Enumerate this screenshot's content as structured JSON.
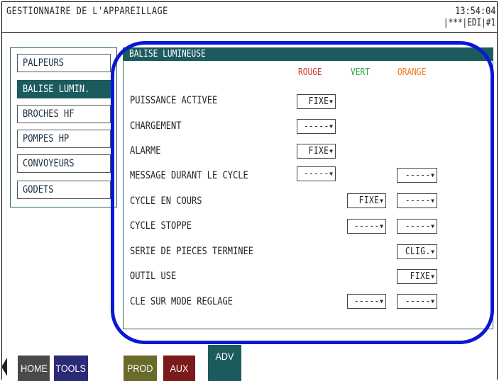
{
  "header": {
    "title": "GESTIONNAIRE DE L'APPAREILLAGE",
    "time": "13:54:04",
    "status": "|***|EDI|#1"
  },
  "menu": {
    "items": [
      {
        "label": "PALPEURS"
      },
      {
        "label": "BALISE LUMIN."
      },
      {
        "label": "BROCHES HF"
      },
      {
        "label": "POMPES HP"
      },
      {
        "label": "CONVOYEURS"
      },
      {
        "label": "GODETS"
      }
    ],
    "active_index": 1
  },
  "panel": {
    "title": "BALISE LUMINEUSE",
    "columns": {
      "rouge": "ROUGE",
      "vert": "VERT",
      "orange": "ORANGE"
    },
    "rows": [
      {
        "label": "PUISSANCE ACTIVEE",
        "rouge": "FIXE",
        "vert": null,
        "orange": null
      },
      {
        "label": "CHARGEMENT",
        "rouge": "-----",
        "vert": null,
        "orange": null
      },
      {
        "label": "ALARME",
        "rouge": "FIXE",
        "vert": null,
        "orange": null
      },
      {
        "label": "MESSAGE DURANT LE CYCLE",
        "rouge": "-----",
        "vert": null,
        "orange": "-----"
      },
      {
        "label": "CYCLE EN COURS",
        "rouge": null,
        "vert": "FIXE",
        "orange": "-----"
      },
      {
        "label": "CYCLE STOPPE",
        "rouge": null,
        "vert": "-----",
        "orange": "-----"
      },
      {
        "label": "SERIE DE PIECES TERMINEE",
        "rouge": null,
        "vert": null,
        "orange": "CLIG."
      },
      {
        "label": "OUTIL USE",
        "rouge": null,
        "vert": null,
        "orange": "FIXE"
      },
      {
        "label": "CLE SUR MODE REGLAGE",
        "rouge": null,
        "vert": "-----",
        "orange": "-----"
      }
    ]
  },
  "nav": {
    "buttons": [
      {
        "label": "HOME",
        "color": "#4a4a4a"
      },
      {
        "label": "TOOLS",
        "color": "#2a2a78"
      },
      {
        "label": "PROD",
        "color": "#6a6a2a"
      },
      {
        "label": "AUX",
        "color": "#7a1a1a"
      },
      {
        "label": "ADV",
        "color": "#1b5b5e"
      }
    ]
  },
  "colors": {
    "accent": "#1b5b5e",
    "highlight_oval": "#0a17d6",
    "rouge": "#d3302b",
    "vert": "#27a63c",
    "orange": "#ef7a1a"
  }
}
